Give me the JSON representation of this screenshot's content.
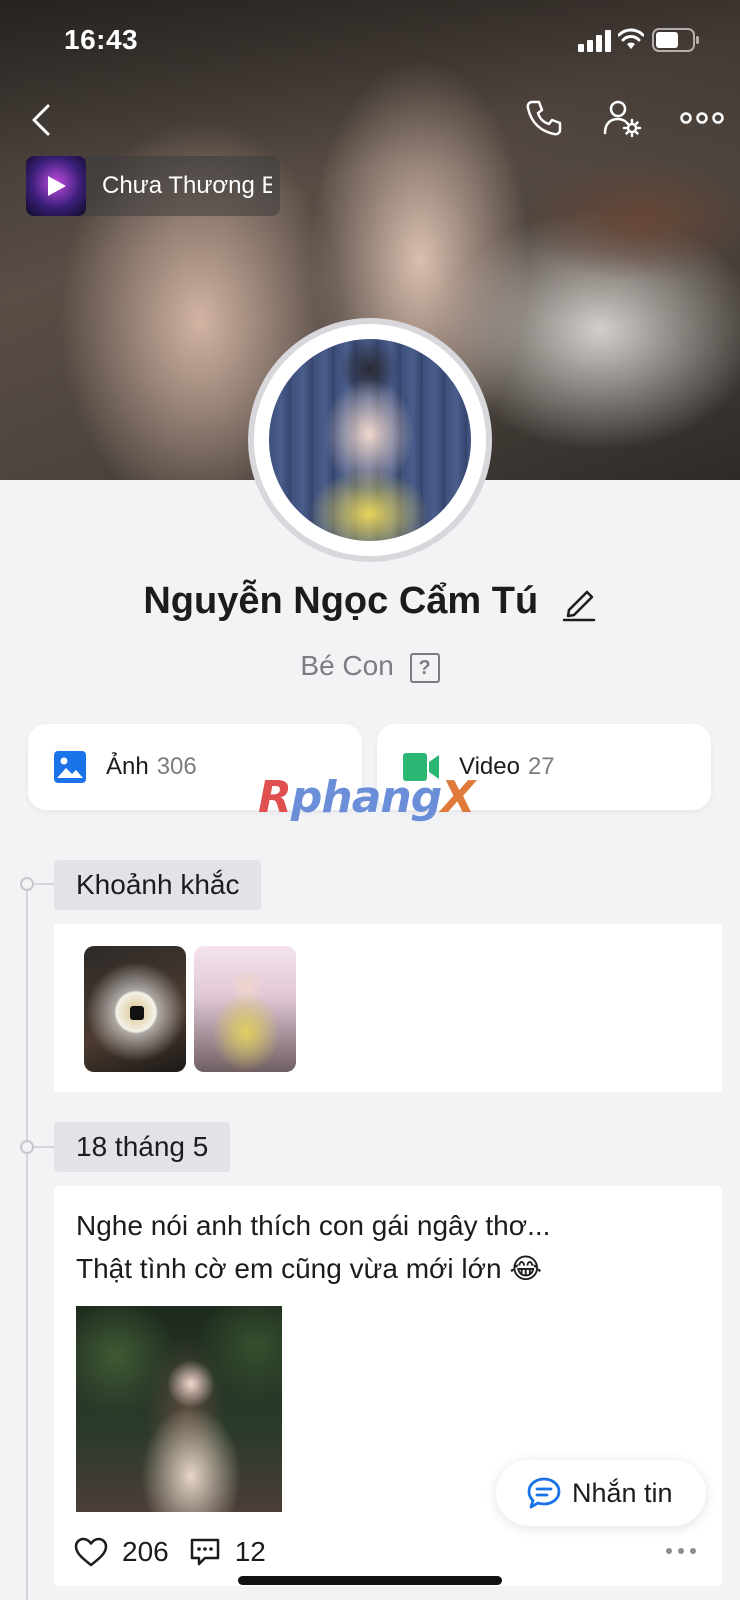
{
  "status_bar": {
    "time": "16:43",
    "icons": [
      "cellular-signal-icon",
      "wifi-icon",
      "battery-icon"
    ]
  },
  "header": {
    "icons": [
      "back-icon",
      "phone-icon",
      "user-settings-icon",
      "more-icon"
    ]
  },
  "music": {
    "title": "Chưa Thương E",
    "icon": "play-icon"
  },
  "profile": {
    "name": "Nguyễn Ngọc Cẩm Tú",
    "bio": "Bé Con",
    "bio_help": "?"
  },
  "media": {
    "photos_label": "Ảnh",
    "photos_count": "306",
    "videos_label": "Video",
    "videos_count": "27",
    "photos_icon_color": "#1a73e8",
    "videos_icon_color": "#2bb673"
  },
  "watermark": {
    "part1": "R",
    "part2": "phang",
    "part3": "X"
  },
  "moments": {
    "label": "Khoảnh khắc"
  },
  "post": {
    "date_label": "18 tháng 5",
    "text_line1": "Nghe nói anh thích con gái ngây thơ...",
    "text_line2": "Thật tình cờ em cũng vừa mới lớn 😂",
    "likes": "206",
    "comments": "12"
  },
  "message_button": {
    "label": "Nhắn tin",
    "accent": "#1a73e8"
  }
}
